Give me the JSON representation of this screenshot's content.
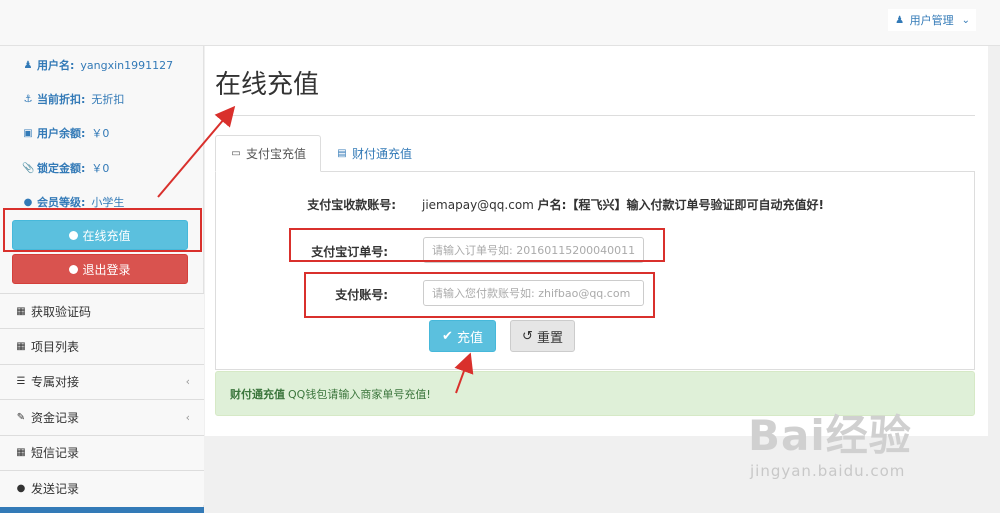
{
  "header": {
    "user_menu_label": "用户管理"
  },
  "sidebar": {
    "info": [
      {
        "label": "用户名:",
        "value": "yangxin1991127"
      },
      {
        "label": "当前折扣:",
        "value": "无折扣"
      },
      {
        "label": "用户余额:",
        "value": "￥0"
      },
      {
        "label": "锁定金额:",
        "value": "￥0"
      },
      {
        "label": "会员等级:",
        "value": "小学生"
      }
    ],
    "recharge_button": "在线充值",
    "logout_button": "退出登录",
    "menu": [
      {
        "label": "获取验证码"
      },
      {
        "label": "项目列表"
      },
      {
        "label": "专属对接"
      },
      {
        "label": "资金记录"
      },
      {
        "label": "短信记录"
      },
      {
        "label": "发送记录"
      }
    ]
  },
  "main": {
    "title": "在线充值",
    "tabs": [
      {
        "label": "支付宝充值"
      },
      {
        "label": "财付通充值"
      }
    ],
    "form": {
      "account_label": "支付宝收款账号:",
      "account_value": "jiemapay@qq.com",
      "account_note_prefix": "户名:",
      "account_note_name": "【程飞兴】",
      "account_note_suffix": "输入付款订单号验证即可自动充值好!",
      "order_label": "支付宝订单号:",
      "order_placeholder": "请输入订单号如: 20160115200040011",
      "payer_label": "支付账号:",
      "payer_placeholder": "请输入您付款账号如: zhifbao@qq.com",
      "submit_label": "充值",
      "reset_label": "重置"
    },
    "alert": {
      "strong": "财付通充值",
      "text": "QQ钱包请输入商家单号充值!"
    }
  },
  "watermark": {
    "logo": "Bai经验",
    "url": "jingyan.baidu.com"
  },
  "colors": {
    "annotation": "#d9302c",
    "info_button": "#5bc0de",
    "danger_button": "#d9534f",
    "link": "#337ab7",
    "alert_bg": "#dff0d8"
  }
}
